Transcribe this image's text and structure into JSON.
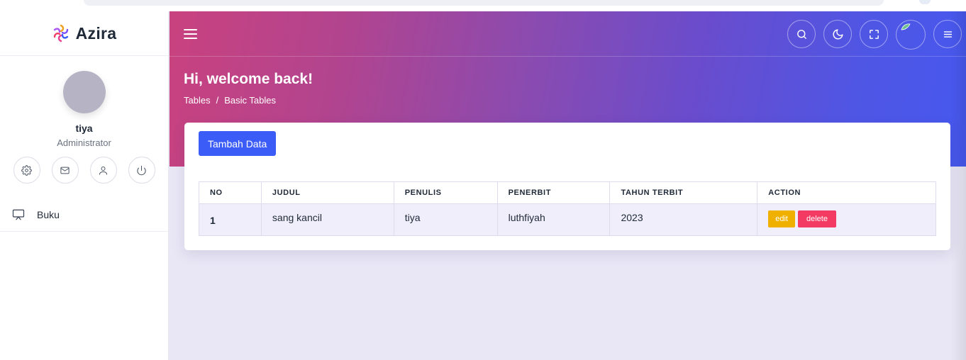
{
  "brand": {
    "name": "Azira",
    "logo_icon": "azira-logo-icon"
  },
  "profile": {
    "name": "tiya",
    "role": "Administrator",
    "actions": [
      "gear-icon",
      "mail-icon",
      "user-icon",
      "power-icon"
    ]
  },
  "sidebar": {
    "items": [
      {
        "label": "Buku",
        "icon": "monitor-icon"
      }
    ]
  },
  "topbar": {
    "icons": [
      "search-icon",
      "moon-icon",
      "fullscreen-icon",
      "avatar",
      "menu-icon"
    ]
  },
  "header": {
    "welcome": "Hi, welcome back!",
    "breadcrumb": {
      "parent": "Tables",
      "separator": "/",
      "current": "Basic Tables"
    }
  },
  "card": {
    "add_button": "Tambah Data",
    "table": {
      "headers": [
        "NO",
        "JUDUL",
        "PENULIS",
        "PENERBIT",
        "TAHUN TERBIT",
        "ACTION"
      ],
      "rows": [
        {
          "no": "1",
          "judul": "sang kancil",
          "penulis": "tiya",
          "penerbit": "luthfiyah",
          "tahun": "2023",
          "edit": "edit",
          "delete": "delete"
        }
      ]
    }
  },
  "colors": {
    "accent": "#3b5cf6",
    "edit": "#f0b000",
    "delete": "#f23a63",
    "hero_start": "#c9427f",
    "hero_end": "#4658ee"
  }
}
